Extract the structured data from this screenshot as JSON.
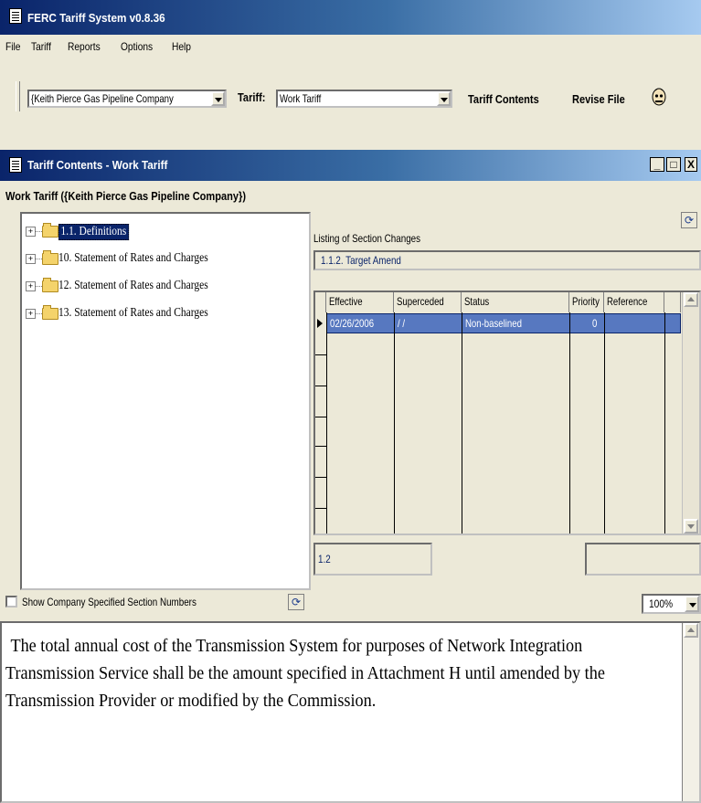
{
  "app": {
    "title": "FERC Tariff System v0.8.36"
  },
  "menu": [
    "File",
    "Tariff",
    "Reports",
    "Options",
    "Help"
  ],
  "toolbar": {
    "company": "{Keith Pierce Gas Pipeline Company",
    "tariff_label": "Tariff:",
    "tariff": "Work Tariff",
    "contents_button": "Tariff Contents",
    "revise_button": "Revise File"
  },
  "window": {
    "title": "Tariff Contents - Work Tariff",
    "subtitle": "Work Tariff ({Keith Pierce Gas Pipeline Company})"
  },
  "tree": {
    "nodes": [
      {
        "label": "1.1. Definitions",
        "selected": true
      },
      {
        "label": "10. Statement of Rates and Charges",
        "selected": false
      },
      {
        "label": "12. Statement of Rates and Charges",
        "selected": false
      },
      {
        "label": "13. Statement of Rates and Charges",
        "selected": false
      }
    ]
  },
  "changes": {
    "label": "Listing of Section Changes",
    "section": "1.1.2. Target Amend",
    "columns": [
      "Effective",
      "Superceded",
      "Status",
      "Priority",
      "Reference"
    ],
    "rows": [
      {
        "effective": "02/26/2006",
        "superceded": "/ /",
        "status": "Non-baselined",
        "priority": "0",
        "reference": ""
      }
    ],
    "status_left": "1.2",
    "status_right": ""
  },
  "options": {
    "show_company_numbers": "Show Company Specified Section Numbers",
    "zoom": "100%"
  },
  "text": "The total annual cost of the Transmission System for purposes of Network Integration Transmission Service shall be the amount specified in Attachment H until amended by the Transmission Provider or modified by the Commission."
}
